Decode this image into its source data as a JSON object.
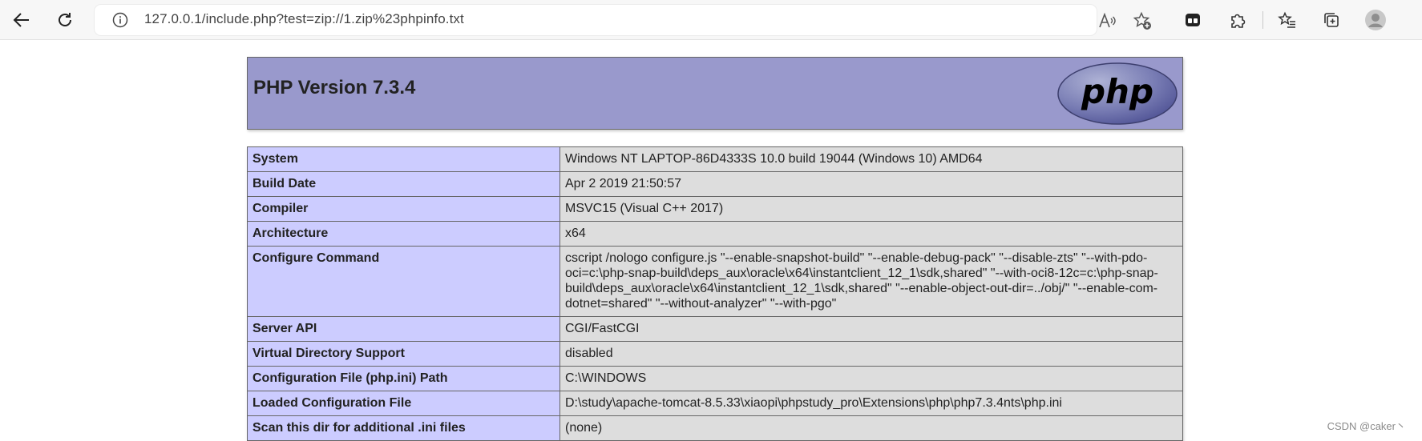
{
  "browser": {
    "url": "127.0.0.1/include.php?test=zip://1.zip%23phpinfo.txt"
  },
  "page": {
    "title": "PHP Version 7.3.4",
    "logo_text": "php",
    "rows": [
      {
        "key": "System",
        "value": "Windows NT LAPTOP-86D4333S 10.0 build 19044 (Windows 10) AMD64"
      },
      {
        "key": "Build Date",
        "value": "Apr 2 2019 21:50:57"
      },
      {
        "key": "Compiler",
        "value": "MSVC15 (Visual C++ 2017)"
      },
      {
        "key": "Architecture",
        "value": "x64"
      },
      {
        "key": "Configure Command",
        "value": "cscript /nologo configure.js \"--enable-snapshot-build\" \"--enable-debug-pack\" \"--disable-zts\" \"--with-pdo-oci=c:\\php-snap-build\\deps_aux\\oracle\\x64\\instantclient_12_1\\sdk,shared\" \"--with-oci8-12c=c:\\php-snap-build\\deps_aux\\oracle\\x64\\instantclient_12_1\\sdk,shared\" \"--enable-object-out-dir=../obj/\" \"--enable-com-dotnet=shared\" \"--without-analyzer\" \"--with-pgo\""
      },
      {
        "key": "Server API",
        "value": "CGI/FastCGI"
      },
      {
        "key": "Virtual Directory Support",
        "value": "disabled"
      },
      {
        "key": "Configuration File (php.ini) Path",
        "value": "C:\\WINDOWS"
      },
      {
        "key": "Loaded Configuration File",
        "value": "D:\\study\\apache-tomcat-8.5.33\\xiaopi\\phpstudy_pro\\Extensions\\php\\php7.3.4nts\\php.ini"
      },
      {
        "key": "Scan this dir for additional .ini files",
        "value": "(none)"
      }
    ]
  },
  "watermark": "CSDN @caker丶"
}
